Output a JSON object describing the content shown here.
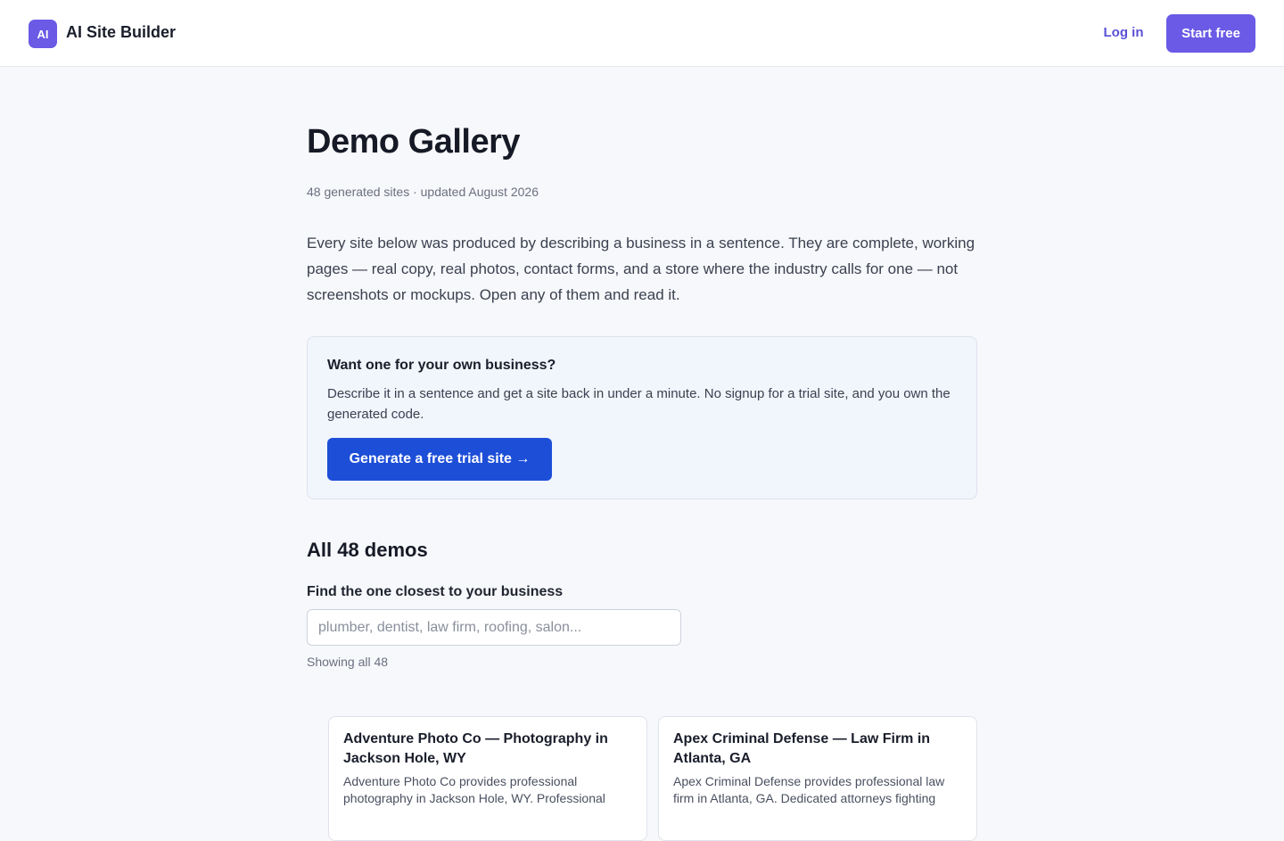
{
  "header": {
    "logo_text": "AI",
    "brand": "AI Site Builder",
    "login_label": "Log in",
    "start_label": "Start free"
  },
  "page": {
    "title": "Demo Gallery",
    "meta": "48 generated sites · updated August 2026",
    "intro": "Every site below was produced by describing a business in a sentence. They are complete, working pages — real copy, real photos, contact forms, and a store where the industry calls for one — not screenshots or mockups. Open any of them and read it."
  },
  "cta": {
    "heading": "Want one for your own business?",
    "text": "Describe it in a sentence and get a site back in under a minute. No signup for a trial site, and you own the generated code.",
    "button_label": "Generate a free trial site →"
  },
  "demos": {
    "section_title": "All 48 demos",
    "search_label": "Find the one closest to your business",
    "search_placeholder": "plumber, dentist, law firm, roofing, salon...",
    "search_value": "",
    "showing_text": "Showing all 48",
    "cards": [
      {
        "title": "Adventure Photo Co — Photography in Jackson Hole, WY",
        "description": "Adventure Photo Co provides professional photography in Jackson Hole, WY. Professional"
      },
      {
        "title": "Apex Criminal Defense — Law Firm in Atlanta, GA",
        "description": "Apex Criminal Defense provides professional law firm in Atlanta, GA. Dedicated attorneys fighting"
      }
    ]
  },
  "colors": {
    "accent": "#6a5ae6",
    "cta_button": "#1d4ed8",
    "page_background": "#f7f8fb"
  }
}
